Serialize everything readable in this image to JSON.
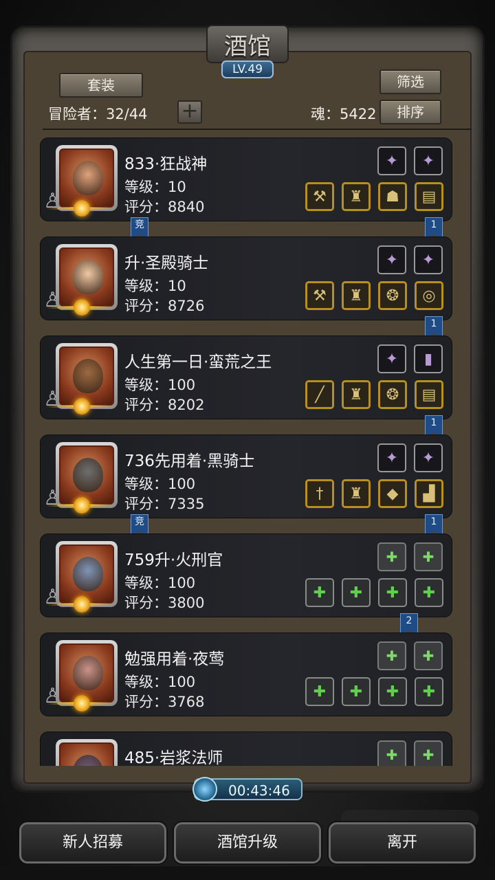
{
  "title": "酒馆",
  "level_badge": "LV.49",
  "header": {
    "suit_button": "套装",
    "filter_button": "筛选",
    "sort_button": "排序",
    "adventurers": "冒险者：32/44",
    "soul": "魂：5422",
    "add_icon": "plus-icon"
  },
  "heroes": [
    {
      "name": "833·狂战神",
      "level": "等级：10",
      "score": "评分：8840",
      "ribbon_left": "竞",
      "ribbon_right": "1",
      "gems": [
        "crystal",
        "crystal"
      ],
      "equips": [
        "axe",
        "armor",
        "mask",
        "scroll"
      ],
      "skin": "#e0a27c",
      "rank": "gold"
    },
    {
      "name": "升·圣殿骑士",
      "level": "等级：10",
      "score": "评分：8726",
      "ribbon_left": "",
      "ribbon_right": "1",
      "gems": [
        "crystal",
        "crystal"
      ],
      "equips": [
        "hammer",
        "armor",
        "amulet",
        "ring"
      ],
      "skin": "#f0c9a5",
      "rank": "gold"
    },
    {
      "name": "人生第一日·蛮荒之王",
      "level": "等级：100",
      "score": "评分：8202",
      "ribbon_left": "",
      "ribbon_right": "1",
      "gems": [
        "crystal",
        "rune"
      ],
      "equips": [
        "spear",
        "armor",
        "amulet",
        "scroll"
      ],
      "skin": "#9c6a42",
      "rank": "moon"
    },
    {
      "name": "736先用着·黑骑士",
      "level": "等级：100",
      "score": "评分：7335",
      "ribbon_left": "竞",
      "ribbon_right": "1",
      "gems": [
        "crystal",
        "crystal"
      ],
      "equips": [
        "sword",
        "armor",
        "gem",
        "boots"
      ],
      "skin": "#6e6e6e",
      "rank": "moon"
    },
    {
      "name": "759升·火刑官",
      "level": "等级：100",
      "score": "评分：3800",
      "ribbon_left": "",
      "ribbon_right": "2",
      "gems": [
        "empty",
        "empty"
      ],
      "equips": [
        "empty",
        "empty",
        "empty",
        "empty"
      ],
      "skin": "#7f95b8",
      "rank": "moon"
    },
    {
      "name": "勉强用着·夜莺",
      "level": "等级：100",
      "score": "评分：3768",
      "ribbon_left": "",
      "ribbon_right": "",
      "gems": [
        "empty",
        "empty"
      ],
      "equips": [
        "empty",
        "empty",
        "empty",
        "empty"
      ],
      "skin": "#c9938a",
      "rank": "moon"
    },
    {
      "name": "485·岩浆法师",
      "level": "",
      "score": "",
      "ribbon_left": "",
      "ribbon_right": "",
      "gems": [
        "empty",
        "empty"
      ],
      "equips": [],
      "skin": "#6d5b7a",
      "rank": "moon"
    }
  ],
  "timer": "00:43:46",
  "bottom": {
    "recruit": "新人招募",
    "upgrade": "酒馆升级",
    "leave": "离开"
  }
}
